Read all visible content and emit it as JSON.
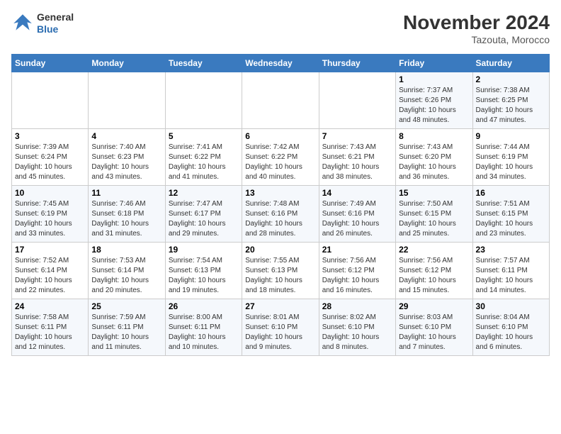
{
  "header": {
    "logo_line1": "General",
    "logo_line2": "Blue",
    "month": "November 2024",
    "location": "Tazouta, Morocco"
  },
  "weekdays": [
    "Sunday",
    "Monday",
    "Tuesday",
    "Wednesday",
    "Thursday",
    "Friday",
    "Saturday"
  ],
  "weeks": [
    [
      {
        "day": "",
        "info": ""
      },
      {
        "day": "",
        "info": ""
      },
      {
        "day": "",
        "info": ""
      },
      {
        "day": "",
        "info": ""
      },
      {
        "day": "",
        "info": ""
      },
      {
        "day": "1",
        "info": "Sunrise: 7:37 AM\nSunset: 6:26 PM\nDaylight: 10 hours\nand 48 minutes."
      },
      {
        "day": "2",
        "info": "Sunrise: 7:38 AM\nSunset: 6:25 PM\nDaylight: 10 hours\nand 47 minutes."
      }
    ],
    [
      {
        "day": "3",
        "info": "Sunrise: 7:39 AM\nSunset: 6:24 PM\nDaylight: 10 hours\nand 45 minutes."
      },
      {
        "day": "4",
        "info": "Sunrise: 7:40 AM\nSunset: 6:23 PM\nDaylight: 10 hours\nand 43 minutes."
      },
      {
        "day": "5",
        "info": "Sunrise: 7:41 AM\nSunset: 6:22 PM\nDaylight: 10 hours\nand 41 minutes."
      },
      {
        "day": "6",
        "info": "Sunrise: 7:42 AM\nSunset: 6:22 PM\nDaylight: 10 hours\nand 40 minutes."
      },
      {
        "day": "7",
        "info": "Sunrise: 7:43 AM\nSunset: 6:21 PM\nDaylight: 10 hours\nand 38 minutes."
      },
      {
        "day": "8",
        "info": "Sunrise: 7:43 AM\nSunset: 6:20 PM\nDaylight: 10 hours\nand 36 minutes."
      },
      {
        "day": "9",
        "info": "Sunrise: 7:44 AM\nSunset: 6:19 PM\nDaylight: 10 hours\nand 34 minutes."
      }
    ],
    [
      {
        "day": "10",
        "info": "Sunrise: 7:45 AM\nSunset: 6:19 PM\nDaylight: 10 hours\nand 33 minutes."
      },
      {
        "day": "11",
        "info": "Sunrise: 7:46 AM\nSunset: 6:18 PM\nDaylight: 10 hours\nand 31 minutes."
      },
      {
        "day": "12",
        "info": "Sunrise: 7:47 AM\nSunset: 6:17 PM\nDaylight: 10 hours\nand 29 minutes."
      },
      {
        "day": "13",
        "info": "Sunrise: 7:48 AM\nSunset: 6:16 PM\nDaylight: 10 hours\nand 28 minutes."
      },
      {
        "day": "14",
        "info": "Sunrise: 7:49 AM\nSunset: 6:16 PM\nDaylight: 10 hours\nand 26 minutes."
      },
      {
        "day": "15",
        "info": "Sunrise: 7:50 AM\nSunset: 6:15 PM\nDaylight: 10 hours\nand 25 minutes."
      },
      {
        "day": "16",
        "info": "Sunrise: 7:51 AM\nSunset: 6:15 PM\nDaylight: 10 hours\nand 23 minutes."
      }
    ],
    [
      {
        "day": "17",
        "info": "Sunrise: 7:52 AM\nSunset: 6:14 PM\nDaylight: 10 hours\nand 22 minutes."
      },
      {
        "day": "18",
        "info": "Sunrise: 7:53 AM\nSunset: 6:14 PM\nDaylight: 10 hours\nand 20 minutes."
      },
      {
        "day": "19",
        "info": "Sunrise: 7:54 AM\nSunset: 6:13 PM\nDaylight: 10 hours\nand 19 minutes."
      },
      {
        "day": "20",
        "info": "Sunrise: 7:55 AM\nSunset: 6:13 PM\nDaylight: 10 hours\nand 18 minutes."
      },
      {
        "day": "21",
        "info": "Sunrise: 7:56 AM\nSunset: 6:12 PM\nDaylight: 10 hours\nand 16 minutes."
      },
      {
        "day": "22",
        "info": "Sunrise: 7:56 AM\nSunset: 6:12 PM\nDaylight: 10 hours\nand 15 minutes."
      },
      {
        "day": "23",
        "info": "Sunrise: 7:57 AM\nSunset: 6:11 PM\nDaylight: 10 hours\nand 14 minutes."
      }
    ],
    [
      {
        "day": "24",
        "info": "Sunrise: 7:58 AM\nSunset: 6:11 PM\nDaylight: 10 hours\nand 12 minutes."
      },
      {
        "day": "25",
        "info": "Sunrise: 7:59 AM\nSunset: 6:11 PM\nDaylight: 10 hours\nand 11 minutes."
      },
      {
        "day": "26",
        "info": "Sunrise: 8:00 AM\nSunset: 6:11 PM\nDaylight: 10 hours\nand 10 minutes."
      },
      {
        "day": "27",
        "info": "Sunrise: 8:01 AM\nSunset: 6:10 PM\nDaylight: 10 hours\nand 9 minutes."
      },
      {
        "day": "28",
        "info": "Sunrise: 8:02 AM\nSunset: 6:10 PM\nDaylight: 10 hours\nand 8 minutes."
      },
      {
        "day": "29",
        "info": "Sunrise: 8:03 AM\nSunset: 6:10 PM\nDaylight: 10 hours\nand 7 minutes."
      },
      {
        "day": "30",
        "info": "Sunrise: 8:04 AM\nSunset: 6:10 PM\nDaylight: 10 hours\nand 6 minutes."
      }
    ]
  ]
}
